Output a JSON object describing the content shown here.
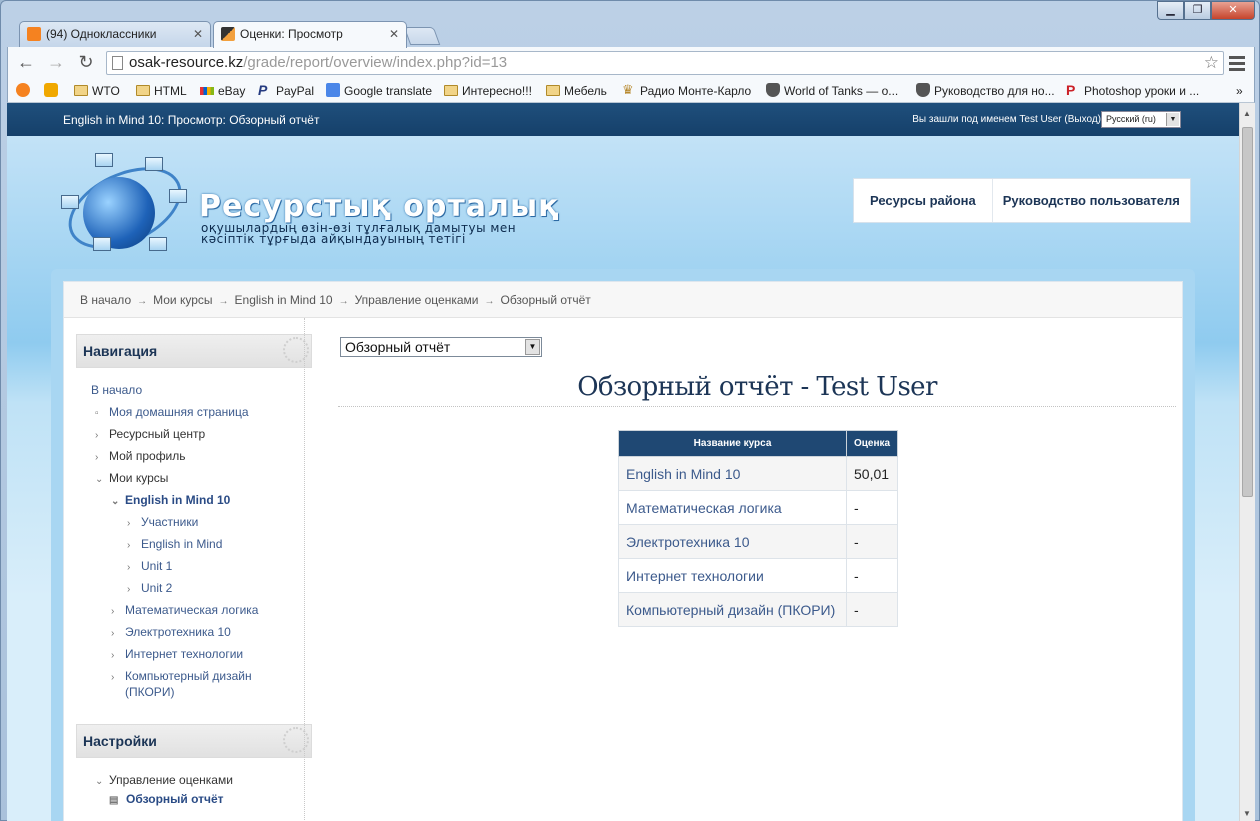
{
  "browser": {
    "tabs": [
      {
        "label": "(94) Одноклассники",
        "favicon": "ok-icon",
        "color": "#f58220"
      },
      {
        "label": "Оценки: Просмотр",
        "favicon": "mortarboard-icon",
        "color": "#f2a03d"
      }
    ],
    "url_host": "osak-resource.kz",
    "url_path": "/grade/report/overview/index.php?id=13",
    "bookmarks": [
      {
        "label": "",
        "icon": "odnoklassniki-icon"
      },
      {
        "label": "",
        "icon": "at-icon"
      },
      {
        "label": "WTO",
        "icon": "folder-icon"
      },
      {
        "label": "HTML",
        "icon": "folder-icon"
      },
      {
        "label": "eBay",
        "icon": "ebay-icon"
      },
      {
        "label": "PayPal",
        "icon": "paypal-icon"
      },
      {
        "label": "Google translate",
        "icon": "translate-icon"
      },
      {
        "label": "Интересно!!!",
        "icon": "folder-icon"
      },
      {
        "label": "Мебель",
        "icon": "folder-icon"
      },
      {
        "label": "Радио Монте-Карло",
        "icon": "crown-icon"
      },
      {
        "label": "World of Tanks — о...",
        "icon": "wot-icon"
      },
      {
        "label": "Руководство для но...",
        "icon": "wot-icon"
      },
      {
        "label": "Photoshop уроки и ...",
        "icon": "pinterest-icon"
      }
    ],
    "bookmarks_more": "»"
  },
  "header": {
    "page_heading": "English in Mind 10: Просмотр: Обзорный отчёт",
    "login_info": "Вы зашли под именем Test User (Выход)",
    "language": "Русский (ru)",
    "brand": "Ресурстық орталық",
    "brand_sub_line1": "оқушылардың өзін-өзі тұлғалық дамытуы мен",
    "brand_sub_line2": "кәсіптік тұрғыда айқындауының тетігі",
    "nav": [
      "Ресурсы района",
      "Руководство пользователя"
    ]
  },
  "breadcrumb": [
    "В начало",
    "Мои курсы",
    "English in Mind 10",
    "Управление оценками",
    "Обзорный отчёт"
  ],
  "navigation": {
    "title": "Навигация",
    "items": [
      {
        "label": "В начало"
      },
      {
        "label": "Моя домашняя страница"
      },
      {
        "label": "Ресурсный центр"
      },
      {
        "label": "Мой профиль"
      },
      {
        "label": "Мои курсы"
      },
      {
        "label": "English in Mind 10"
      },
      {
        "label": "Участники"
      },
      {
        "label": "English in Mind"
      },
      {
        "label": "Unit 1"
      },
      {
        "label": "Unit 2"
      },
      {
        "label": "Математическая логика"
      },
      {
        "label": "Электротехника 10"
      },
      {
        "label": "Интернет технологии"
      },
      {
        "label": "Компьютерный дизайн"
      },
      {
        "label": "(ПКОРИ)"
      }
    ]
  },
  "settings": {
    "title": "Настройки",
    "items": [
      {
        "label": "Управление оценками"
      },
      {
        "label": "Обзорный отчёт"
      }
    ]
  },
  "report": {
    "selector": "Обзорный отчёт",
    "title": "Обзорный отчёт - Test User",
    "col_course": "Название курса",
    "col_grade": "Оценка",
    "rows": [
      {
        "course": "English in Mind 10",
        "grade": "50,01"
      },
      {
        "course": "Математическая логика",
        "grade": "-"
      },
      {
        "course": "Электротехника 10",
        "grade": "-"
      },
      {
        "course": "Интернет технологии",
        "grade": "-"
      },
      {
        "course": "Компьютерный дизайн (ПКОРИ)",
        "grade": "-"
      }
    ]
  }
}
